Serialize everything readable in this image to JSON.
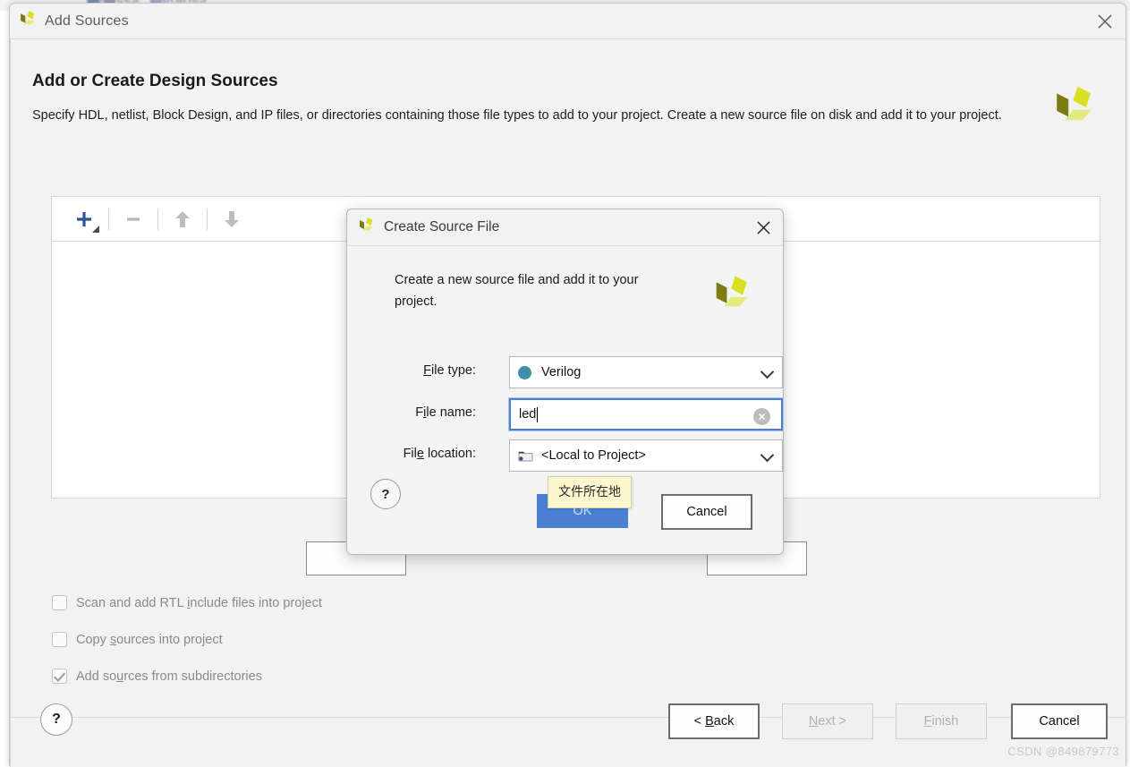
{
  "window": {
    "title": "Add Sources",
    "close_icon": "close-icon",
    "logo_icon": "vivado-logo-icon"
  },
  "page": {
    "heading": "Add or Create Design Sources",
    "description": "Specify HDL, netlist, Block Design, and IP files, or directories containing those file types to add to your project. Create a new source file on disk and add it to your project.",
    "logo_icon": "vivado-logo-icon"
  },
  "toolbar": {
    "add_icon": "plus-icon",
    "remove_icon": "minus-icon",
    "move_up_icon": "arrow-up-icon",
    "move_down_icon": "arrow-down-icon"
  },
  "checkboxes": [
    {
      "label_pre": "Scan and add RTL ",
      "label_key": "i",
      "label_post": "nclude files into project",
      "checked": false
    },
    {
      "label_pre": "Copy ",
      "label_key": "s",
      "label_post": "ources into project",
      "checked": false
    },
    {
      "label_pre": "Add so",
      "label_key": "u",
      "label_post": "rces from subdirectories",
      "checked": true
    }
  ],
  "footer": {
    "help_label": "?",
    "buttons": [
      {
        "pre": "< ",
        "key": "B",
        "post": "ack",
        "disabled": false,
        "name": "back-button"
      },
      {
        "pre": "",
        "key": "N",
        "post": "ext >",
        "disabled": true,
        "name": "next-button"
      },
      {
        "pre": "",
        "key": "F",
        "post": "inish",
        "disabled": true,
        "name": "finish-button"
      },
      {
        "pre": "",
        "key": "",
        "post": "Cancel",
        "disabled": false,
        "name": "cancel-button"
      }
    ]
  },
  "watermark": "CSDN @849879773",
  "dialog": {
    "title": "Create Source File",
    "close_icon": "close-icon",
    "logo_icon": "vivado-logo-icon",
    "description": "Create a new source file and add it to your project.",
    "fields": [
      {
        "label_pre": "",
        "label_key": "F",
        "label_post": "ile type:",
        "value": "Verilog",
        "control": "dropdown",
        "icon": "verilog-dot-icon",
        "name": "file-type-dropdown"
      },
      {
        "label_pre": "F",
        "label_key": "i",
        "label_post": "le name:",
        "value": "led",
        "control": "textinput",
        "placeholder": "",
        "focused": true,
        "clear_icon": "clear-icon",
        "name": "file-name-input"
      },
      {
        "label_pre": "Fil",
        "label_key": "e",
        "label_post": " location:",
        "value": "<Local to Project>",
        "control": "dropdown",
        "icon": "folder-icon",
        "name": "file-location-dropdown"
      }
    ],
    "help_label": "?",
    "ok_label": "OK",
    "cancel_label": "Cancel",
    "tooltip": "文件所在地"
  },
  "colors": {
    "accent_blue": "#4a7fd1",
    "verilog_dot": "#3f8fa8",
    "logo_bright": "#d9e021",
    "logo_dark": "#7c7b14",
    "logo_light": "#e3ea7e",
    "tooltip_bg": "#fdf7cf"
  }
}
